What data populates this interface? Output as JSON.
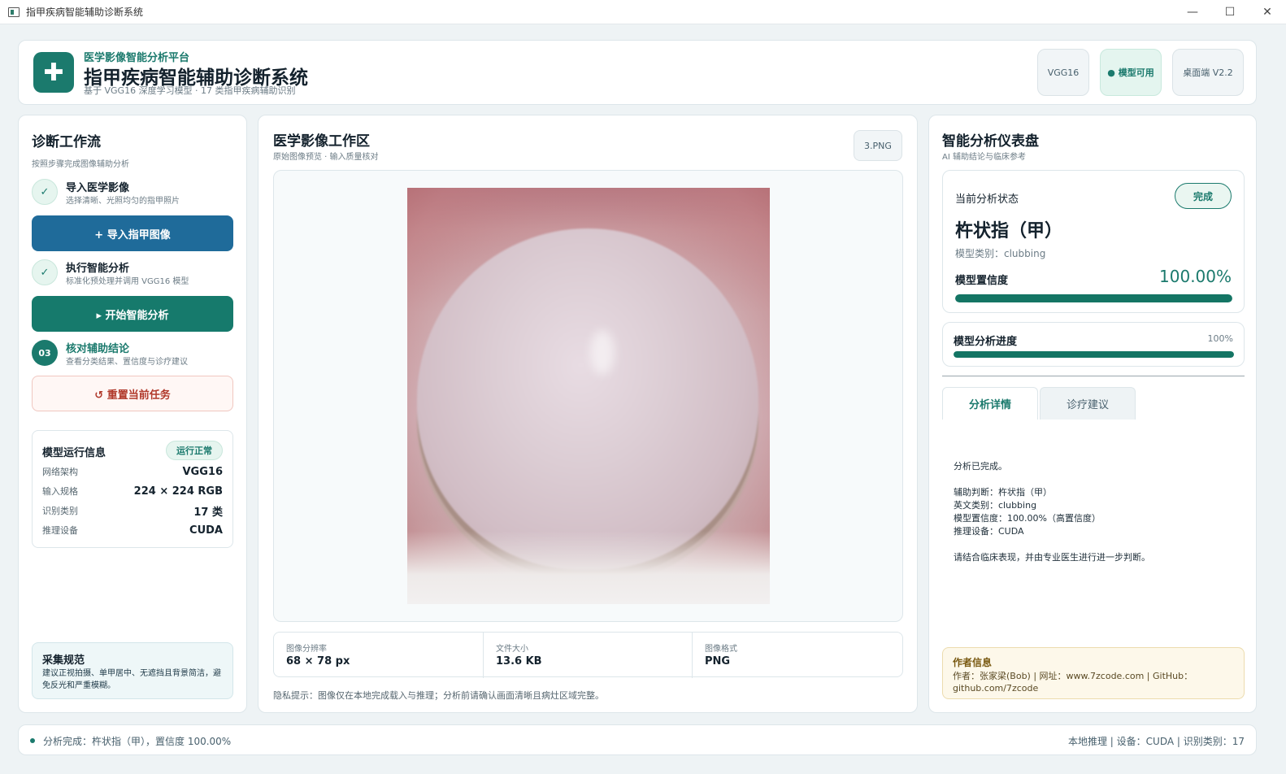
{
  "window": {
    "title": "指甲疾病智能辅助诊断系统",
    "controls": {
      "minimize": "—",
      "maximize": "☐",
      "close": "✕"
    }
  },
  "header": {
    "logo_icon": "medical-cross-icon",
    "logo_glyph": "✚",
    "subtitle": "医学影像智能分析平台",
    "title": "指甲疾病智能辅助诊断系统",
    "description": "基于 VGG16 深度学习模型 · 17 类指甲疾病辅助识别",
    "badges": {
      "model": "VGG16",
      "status": "● 模型可用",
      "version": "桌面端 V2.2"
    }
  },
  "workflow": {
    "title": "诊断工作流",
    "subtitle": "按照步骤完成图像辅助分析",
    "steps": [
      {
        "marker": "✓",
        "title": "导入医学影像",
        "desc": "选择清晰、光照均匀的指甲照片"
      },
      {
        "marker": "✓",
        "title": "执行智能分析",
        "desc": "标准化预处理并调用 VGG16 模型"
      },
      {
        "marker": "03",
        "title": "核对辅助结论",
        "desc": "查看分类结果、置信度与诊疗建议"
      }
    ],
    "buttons": {
      "import": "+   导入指甲图像",
      "analyze": "▸  开始智能分析",
      "reset": "↺  重置当前任务"
    },
    "model_info": {
      "title": "模型运行信息",
      "badge": "运行正常",
      "rows": [
        {
          "key": "网络架构",
          "value": "VGG16"
        },
        {
          "key": "输入规格",
          "value": "224 × 224 RGB"
        },
        {
          "key": "识别类别",
          "value": "17 类"
        },
        {
          "key": "推理设备",
          "value": "CUDA"
        }
      ]
    },
    "tips": {
      "title": "采集规范",
      "text": "建议正视拍摄、单甲居中、无遮挡且背景简洁，避免反光和严重模糊。"
    }
  },
  "workspace": {
    "title": "医学影像工作区",
    "subtitle": "原始图像预览 · 输入质量核对",
    "file_name": "3.PNG",
    "meta": [
      {
        "label": "图像分辨率",
        "value": "68 × 78 px"
      },
      {
        "label": "文件大小",
        "value": "13.6 KB"
      },
      {
        "label": "图像格式",
        "value": "PNG"
      }
    ],
    "privacy": "隐私提示：图像仅在本地完成载入与推理；分析前请确认画面清晰且病灶区域完整。"
  },
  "dashboard": {
    "title": "智能分析仪表盘",
    "subtitle": "AI 辅助结论与临床参考",
    "status_label": "当前分析状态",
    "status_value": "完成",
    "result": "杵状指（甲）",
    "category": "模型类别：clubbing",
    "confidence_label": "模型置信度",
    "confidence_value": "100.00%",
    "confidence_fraction": 1.0,
    "progress_label": "模型分析进度",
    "progress_value": "100%",
    "progress_fraction": 1.0,
    "tabs": [
      "分析详情",
      "诊疗建议"
    ],
    "details": "分析已完成。\n\n辅助判断：杵状指（甲）\n英文类别：clubbing\n模型置信度：100.00%（高置信度）\n推理设备：CUDA\n\n请结合临床表现，并由专业医生进行进一步判断。",
    "author": {
      "title": "作者信息",
      "text": "作者：张家梁(Bob) | 网址：www.7zcode.com | GitHub：github.com/7zcode"
    }
  },
  "statusbar": {
    "message": "分析完成：杵状指（甲），置信度 100.00%",
    "right": "本地推理 | 设备：CUDA | 识别类别：17"
  }
}
